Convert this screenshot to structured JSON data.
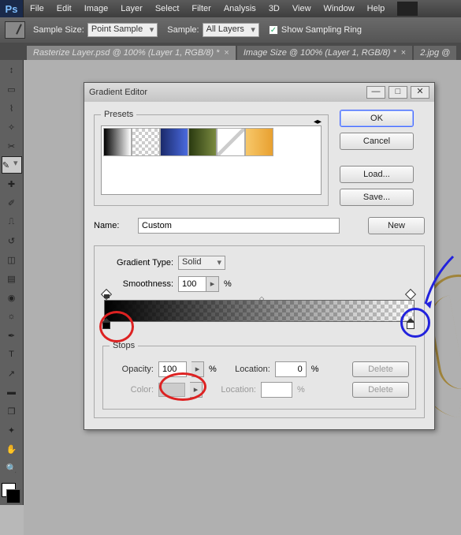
{
  "menu": {
    "items": [
      "File",
      "Edit",
      "Image",
      "Layer",
      "Select",
      "Filter",
      "Analysis",
      "3D",
      "View",
      "Window",
      "Help"
    ]
  },
  "optbar": {
    "sample_size_label": "Sample Size:",
    "sample_size_value": "Point Sample",
    "sample_label": "Sample:",
    "sample_value": "All Layers",
    "show_ring_label": "Show Sampling Ring",
    "show_ring_checked": "✓"
  },
  "tabs": {
    "t0": "Rasterize Layer.psd @ 100% (Layer 1, RGB/8) *",
    "t1": "Image Size @ 100% (Layer 1, RGB/8) *",
    "t2": "2.jpg @"
  },
  "dialog": {
    "title": "Gradient Editor",
    "ok": "OK",
    "cancel": "Cancel",
    "load": "Load...",
    "save": "Save...",
    "new": "New",
    "presets_legend": "Presets",
    "name_label": "Name:",
    "name_value": "Custom",
    "type_label": "Gradient Type:",
    "type_value": "Solid",
    "smooth_label": "Smoothness:",
    "smooth_value": "100",
    "pct": "%",
    "stops_legend": "Stops",
    "opacity_label": "Opacity:",
    "opacity_value": "100",
    "location_label": "Location:",
    "location_value": "0",
    "color_label": "Color:",
    "location2_value": "",
    "delete": "Delete"
  }
}
